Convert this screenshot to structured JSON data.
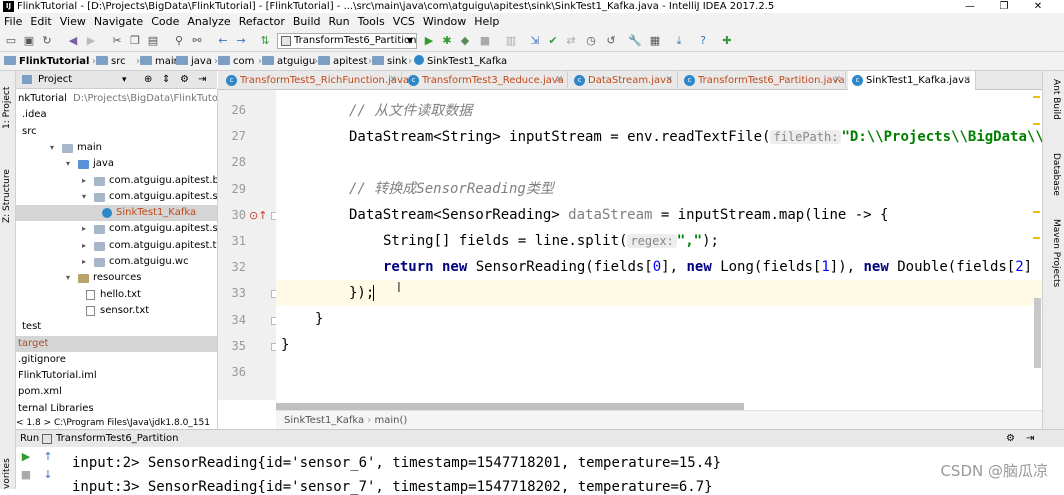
{
  "window": {
    "title": "FlinkTutorial - [D:\\Projects\\BigData\\FlinkTutorial] - [FlinkTutorial] - ...\\src\\main\\java\\com\\atguigu\\apitest\\sink\\SinkTest1_Kafka.java - IntelliJ IDEA 2017.2.5",
    "app_icon": "IJ",
    "minimize": "—",
    "maximize": "❐",
    "close": "✕"
  },
  "menu": [
    "File",
    "Edit",
    "View",
    "Navigate",
    "Code",
    "Analyze",
    "Refactor",
    "Build",
    "Run",
    "Tools",
    "VCS",
    "Window",
    "Help"
  ],
  "toolbar": {
    "run_config": "TransformTest6_Partition"
  },
  "nav": {
    "project": "FlinkTutorial",
    "crumbs": [
      "src",
      "main",
      "java",
      "com",
      "atguigu",
      "apitest",
      "sink",
      "SinkTest1_Kafka"
    ]
  },
  "project_panel": {
    "title": "Project"
  },
  "tabs": [
    {
      "label": "TransformTest5_RichFunction.java",
      "active": false
    },
    {
      "label": "TransformTest3_Reduce.java",
      "active": false
    },
    {
      "label": "DataStream.java",
      "active": false
    },
    {
      "label": "TransformTest6_Partition.java",
      "active": false
    },
    {
      "label": "SinkTest1_Kafka.java",
      "active": true
    }
  ],
  "tree": [
    {
      "label": "nkTutorial",
      "extra": "D:\\Projects\\BigData\\FlinkTutorial",
      "indent": 0,
      "icon": "none"
    },
    {
      "label": ".idea",
      "indent": 1,
      "icon": "none"
    },
    {
      "label": "src",
      "indent": 1,
      "icon": "none"
    },
    {
      "label": "main",
      "indent": 2,
      "icon": "folder",
      "arrow": "▾"
    },
    {
      "label": "java",
      "indent": 3,
      "icon": "folder",
      "arrow": "▾"
    },
    {
      "label": "com.atguigu.apitest.beans",
      "indent": 4,
      "icon": "folder",
      "arrow": "▸"
    },
    {
      "label": "com.atguigu.apitest.sink",
      "indent": 4,
      "icon": "folder",
      "arrow": "▾"
    },
    {
      "label": "SinkTest1_Kafka",
      "indent": 5,
      "icon": "class",
      "selected": true
    },
    {
      "label": "com.atguigu.apitest.source",
      "indent": 4,
      "icon": "folder",
      "arrow": "▸"
    },
    {
      "label": "com.atguigu.apitest.transform",
      "indent": 4,
      "icon": "folder",
      "arrow": "▸"
    },
    {
      "label": "com.atguigu.wc",
      "indent": 4,
      "icon": "folder",
      "arrow": "▸"
    },
    {
      "label": "resources",
      "indent": 3,
      "icon": "folder",
      "arrow": "▾"
    },
    {
      "label": "hello.txt",
      "indent": 4,
      "icon": "file"
    },
    {
      "label": "sensor.txt",
      "indent": 4,
      "icon": "file"
    },
    {
      "label": "test",
      "indent": 1,
      "icon": "none"
    },
    {
      "label": "target",
      "indent": 0,
      "icon": "none",
      "selected": true
    },
    {
      "label": ".gitignore",
      "indent": 0,
      "icon": "none"
    },
    {
      "label": "FlinkTutorial.iml",
      "indent": 0,
      "icon": "none"
    },
    {
      "label": "pom.xml",
      "indent": 0,
      "icon": "none"
    },
    {
      "label": "ternal Libraries",
      "indent": 0,
      "icon": "none"
    }
  ],
  "tree_bottom": "< 1.8 > C:\\Program Files\\Java\\jdk1.8.0_151",
  "editor": {
    "line_numbers": [
      "26",
      "27",
      "28",
      "29",
      "30",
      "31",
      "32",
      "33",
      "34",
      "35",
      "36"
    ],
    "lines": {
      "l26": "// 从文件读取数据",
      "l27_a": "DataStream<String> inputStream = env.readTextFile(",
      "l27_hint": "filePath:",
      "l27_str": "\"D:\\\\Projects\\\\BigData\\\\",
      "l29": "// 转换成SensorReading类型",
      "l30_a": "DataStream<SensorReading> ",
      "l30_var": "dataStream",
      "l30_b": " = inputStream.map(line -> {",
      "l31_a": "String[] fields = line.split(",
      "l31_hint": "regex:",
      "l31_str": "\",\"",
      "l31_b": ");",
      "l32_kw": "return new",
      "l32_a": " SensorReading(fields[",
      "l32_n0": "0",
      "l32_b": "], ",
      "l32_kw2": "new",
      "l32_c": " Long(fields[",
      "l32_n1": "1",
      "l32_d": "]), ",
      "l32_kw3": "new",
      "l32_e": " Double(fields[",
      "l32_n2": "2",
      "l32_f": "]",
      "l33": "});",
      "l34": "}",
      "l35": "}"
    },
    "breadcrumb": [
      "SinkTest1_Kafka",
      "main()"
    ]
  },
  "left_strip": [
    "1: Project",
    "Z: Structure",
    "vorites"
  ],
  "right_strip": [
    "Ant Build",
    "Database",
    "Maven Projects"
  ],
  "run_panel": {
    "label": "Run",
    "config": "TransformTest6_Partition",
    "output": [
      "input:2> SensorReading{id='sensor_6', timestamp=1547718201, temperature=15.4}",
      "input:3> SensorReading{id='sensor_7', timestamp=1547718202, temperature=6.7}"
    ]
  },
  "watermark": "CSDN @脑瓜凉"
}
